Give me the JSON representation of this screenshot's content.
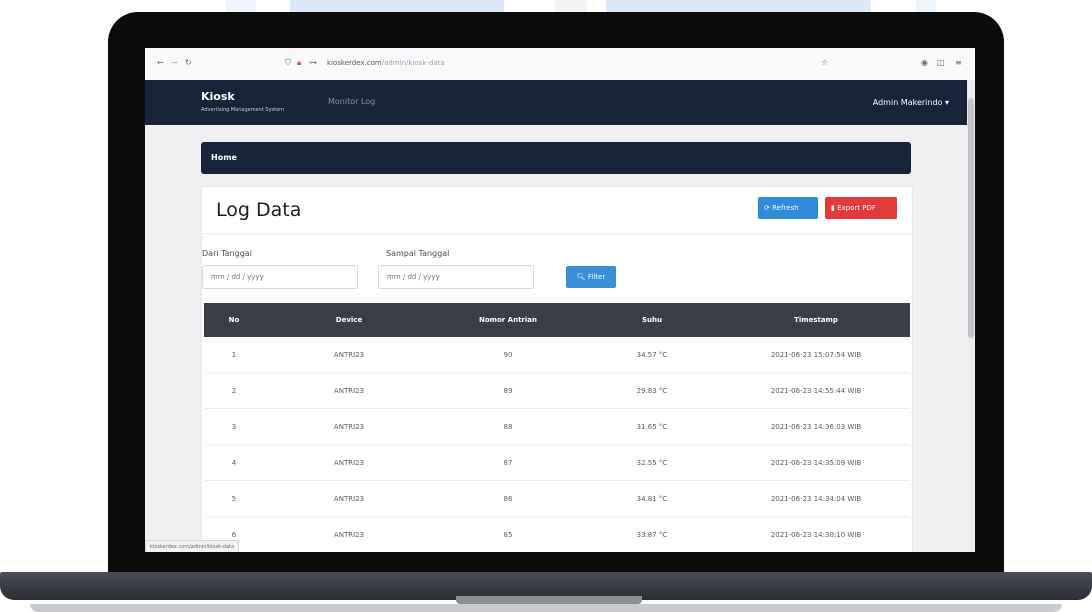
{
  "browser": {
    "url": "kioskerdex.com/admin/kiosk-data",
    "url_host": "kioskerdex.com",
    "url_path": "/admin/kiosk-data"
  },
  "navbar": {
    "brand": "Kiosk",
    "brand_sub": "Advertising Management System",
    "link": "Monitor Log",
    "user": "Admin Makerindo ▾"
  },
  "breadcrumb": "Home",
  "page": {
    "title": "Log Data",
    "refresh_label": "Refresh",
    "export_label": "Export PDF"
  },
  "filters": {
    "from_label": "Dari Tanggal",
    "from_placeholder": "mm / dd / yyyy",
    "to_label": "Sampai Tanggal",
    "to_placeholder": "mm / dd / yyyy",
    "filter_label": "Filter"
  },
  "table": {
    "headers": [
      "No",
      "Device",
      "Nomor Antrian",
      "Suhu",
      "Timestamp"
    ],
    "rows": [
      [
        "1",
        "ANTRI23",
        "90",
        "34.57 °C",
        "2021-06-23 15:07:54 WIB"
      ],
      [
        "2",
        "ANTRI23",
        "89",
        "29.83 °C",
        "2021-06-23 14:55:44 WIB"
      ],
      [
        "3",
        "ANTRI23",
        "88",
        "31.65 °C",
        "2021-06-23 14:36:03 WIB"
      ],
      [
        "4",
        "ANTRI23",
        "87",
        "32.55 °C",
        "2021-06-23 14:35:09 WIB"
      ],
      [
        "5",
        "ANTRI23",
        "86",
        "34.81 °C",
        "2021-06-23 14:34:04 WIB"
      ],
      [
        "6",
        "ANTRI23",
        "85",
        "33.87 °C",
        "2021-06-23 14:30:10 WIB"
      ]
    ]
  },
  "status_url": "kioskerdex.com/admin/kiosk-data"
}
